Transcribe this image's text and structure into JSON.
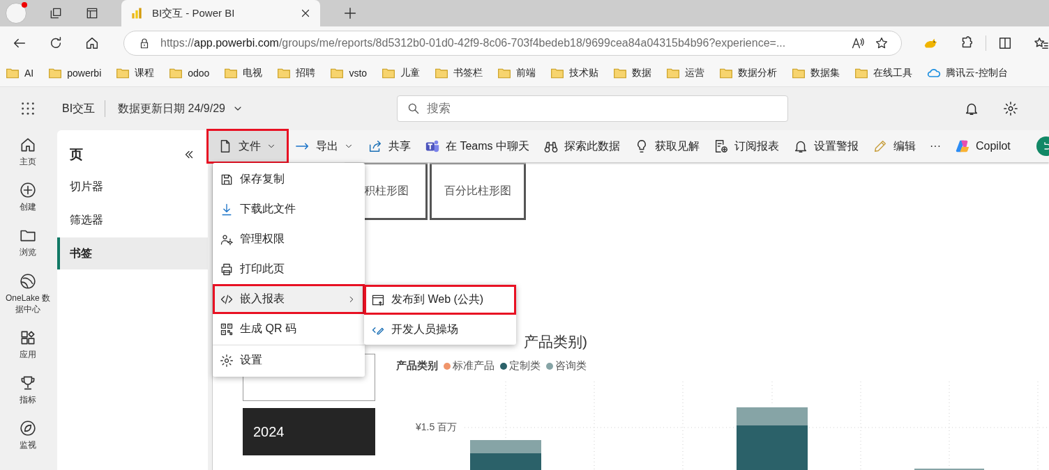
{
  "browser": {
    "tabs": [
      {
        "title": "BI交互 - Power BI",
        "selected": true
      }
    ],
    "url": {
      "scheme": "https://",
      "host": "app.powerbi.com",
      "path": "/groups/me/reports/8d5312b0-01d0-42f9-8c06-703f4bedeb18/9699cea84a04315b4b96?experience=..."
    },
    "bookmarks": [
      {
        "label": "AI",
        "kind": "folder"
      },
      {
        "label": "powerbi",
        "kind": "folder"
      },
      {
        "label": "课程",
        "kind": "folder"
      },
      {
        "label": "odoo",
        "kind": "folder"
      },
      {
        "label": "电视",
        "kind": "folder"
      },
      {
        "label": "招聘",
        "kind": "folder"
      },
      {
        "label": "vsto",
        "kind": "folder"
      },
      {
        "label": "儿童",
        "kind": "folder"
      },
      {
        "label": "书签栏",
        "kind": "folder"
      },
      {
        "label": "前端",
        "kind": "folder"
      },
      {
        "label": "技术贴",
        "kind": "folder"
      },
      {
        "label": "数据",
        "kind": "folder"
      },
      {
        "label": "运营",
        "kind": "folder"
      },
      {
        "label": "数据分析",
        "kind": "folder"
      },
      {
        "label": "数据集",
        "kind": "folder"
      },
      {
        "label": "在线工具",
        "kind": "folder"
      },
      {
        "label": "腾讯云-控制台",
        "kind": "cloud"
      }
    ]
  },
  "header": {
    "report_name": "BI交互",
    "refresh_date": "数据更新日期 24/9/29",
    "search": {
      "placeholder": "搜索"
    }
  },
  "nav_rail": [
    {
      "label": "主页"
    },
    {
      "label": "创建"
    },
    {
      "label": "浏览"
    },
    {
      "label": "OneLake 数据中心"
    },
    {
      "label": "应用"
    },
    {
      "label": "指标"
    },
    {
      "label": "监视"
    }
  ],
  "pages_panel": {
    "title": "页",
    "items": [
      {
        "label": "切片器",
        "selected": false
      },
      {
        "label": "筛选器",
        "selected": false
      },
      {
        "label": "书签",
        "selected": true
      }
    ]
  },
  "toolbar": [
    {
      "label": "文件",
      "caret": true,
      "expanded": true,
      "highlighted": true
    },
    {
      "label": "导出",
      "caret": true,
      "expanded": false,
      "highlighted": false
    },
    {
      "label": "共享",
      "caret": false,
      "expanded": false,
      "highlighted": false
    },
    {
      "label": "在 Teams 中聊天",
      "caret": false,
      "expanded": false,
      "highlighted": false
    },
    {
      "label": "探索此数据",
      "caret": false,
      "expanded": false,
      "highlighted": false
    },
    {
      "label": "获取见解",
      "caret": false,
      "expanded": false,
      "highlighted": false
    },
    {
      "label": "订阅报表",
      "caret": false,
      "expanded": false,
      "highlighted": false
    },
    {
      "label": "设置警报",
      "caret": false,
      "expanded": false,
      "highlighted": false
    },
    {
      "label": "编辑",
      "caret": false,
      "expanded": false,
      "highlighted": false
    },
    {
      "label": "···",
      "caret": false,
      "expanded": false,
      "highlighted": false
    },
    {
      "label": "Copilot",
      "caret": false,
      "expanded": false,
      "highlighted": false
    }
  ],
  "file_menu": [
    {
      "label": "保存复制",
      "submenu": false,
      "selected": false,
      "divider_before": false,
      "highlighted": false
    },
    {
      "label": "下载此文件",
      "submenu": false,
      "selected": false,
      "divider_before": false,
      "highlighted": false
    },
    {
      "label": "管理权限",
      "submenu": false,
      "selected": false,
      "divider_before": false,
      "highlighted": false
    },
    {
      "label": "打印此页",
      "submenu": false,
      "selected": false,
      "divider_before": false,
      "highlighted": false
    },
    {
      "label": "嵌入报表",
      "submenu": true,
      "selected": true,
      "divider_before": false,
      "highlighted": true
    },
    {
      "label": "生成 QR 码",
      "submenu": false,
      "selected": false,
      "divider_before": false,
      "highlighted": false
    },
    {
      "label": "设置",
      "submenu": false,
      "selected": false,
      "divider_before": true,
      "highlighted": false
    }
  ],
  "submenu": [
    {
      "label": "发布到 Web (公共)",
      "highlighted": true
    },
    {
      "label": "开发人员操场",
      "highlighted": false
    }
  ],
  "canvas": {
    "chart_buttons": [
      {
        "label": "积柱形图"
      },
      {
        "label": "百分比柱形图"
      }
    ],
    "slicer": [
      {
        "selected": false
      },
      {
        "label": "2024",
        "selected": true
      }
    ],
    "chart": {
      "title": "产品类别)",
      "legend_title": "产品类别",
      "legend": [
        {
          "label": "标准产品",
          "color": "#f0956a"
        },
        {
          "label": "定制类",
          "color": "#2b6169"
        },
        {
          "label": "咨询类",
          "color": "#86a4a6"
        }
      ],
      "y_tick": "¥1.5 百万"
    }
  }
}
